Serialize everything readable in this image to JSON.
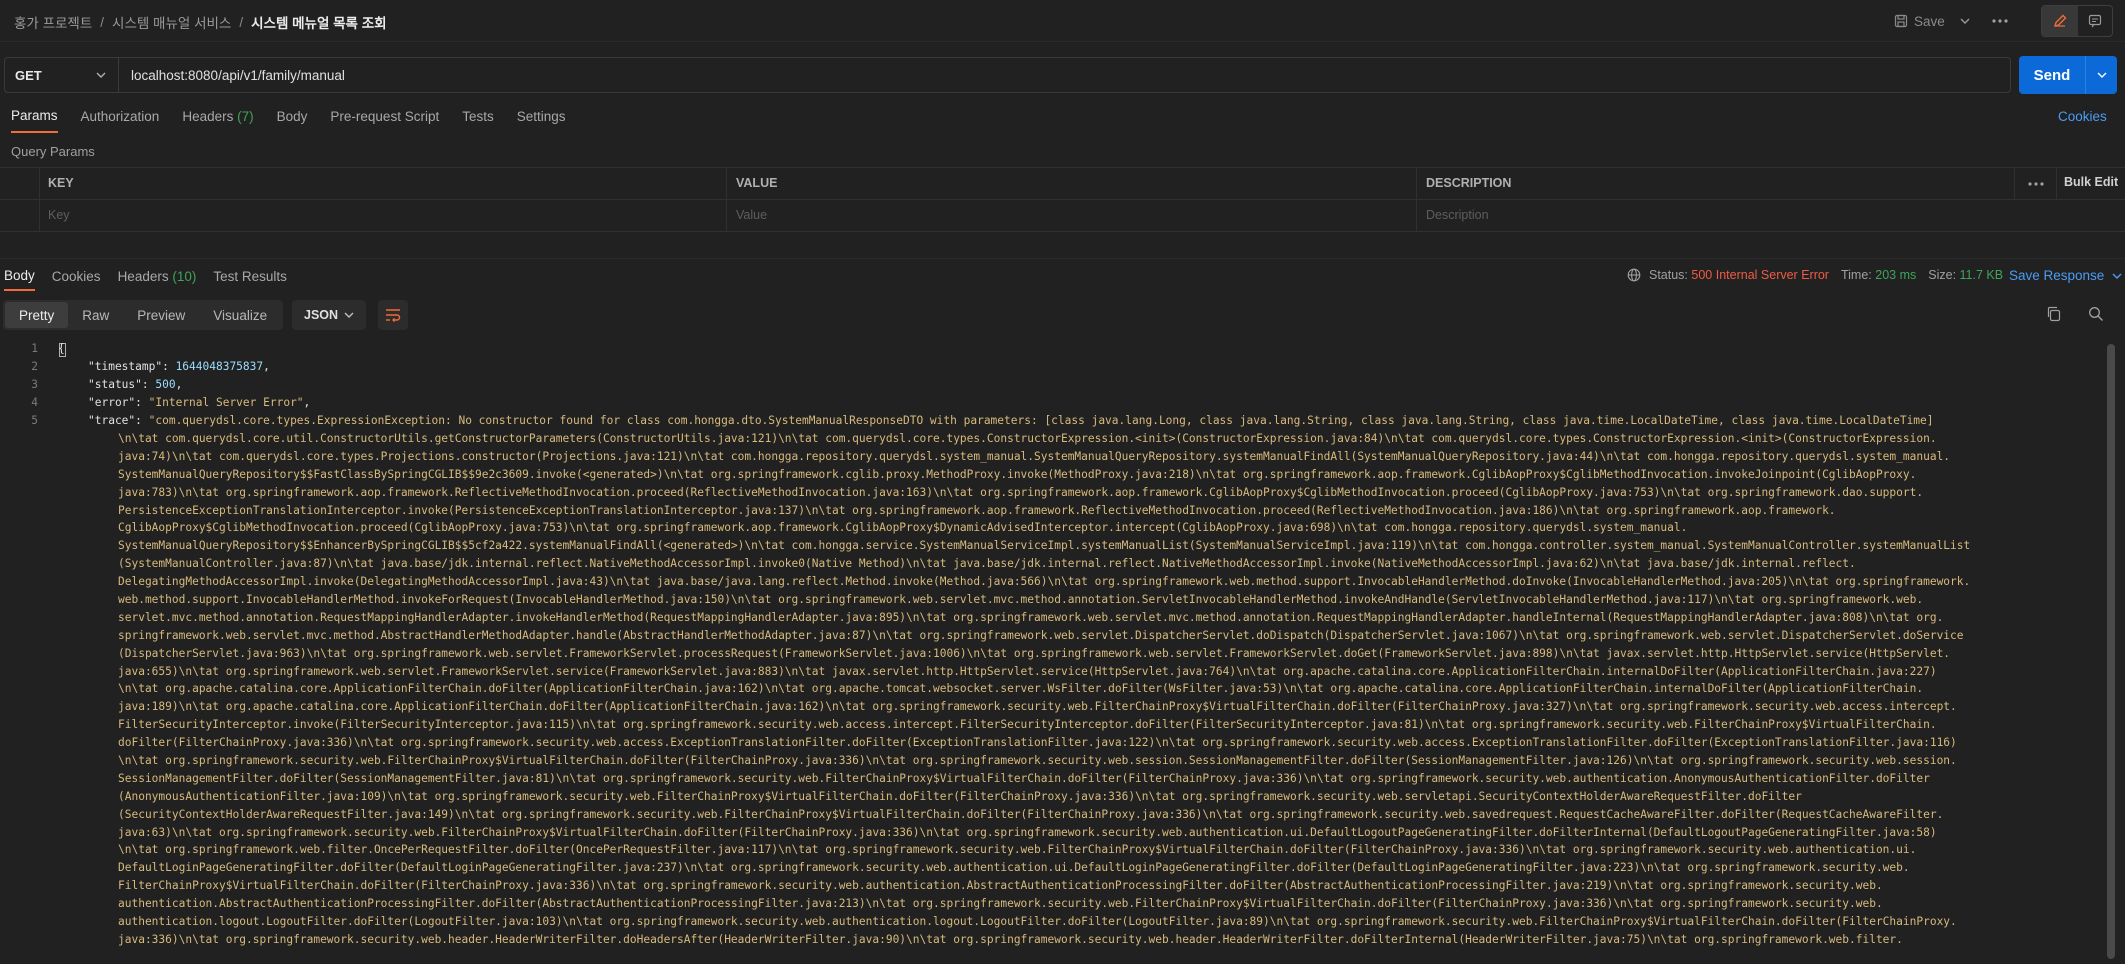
{
  "header": {
    "breadcrumb": [
      "홍가 프로젝트",
      "시스템 매뉴얼 서비스",
      "시스템 메뉴얼 목록 조회"
    ],
    "save_label": "Save"
  },
  "request": {
    "method": "GET",
    "url": "localhost:8080/api/v1/family/manual",
    "send_label": "Send"
  },
  "req_tabs": [
    {
      "label": "Params",
      "count": ""
    },
    {
      "label": "Authorization",
      "count": ""
    },
    {
      "label": "Headers",
      "count": "(7)"
    },
    {
      "label": "Body",
      "count": ""
    },
    {
      "label": "Pre-request Script",
      "count": ""
    },
    {
      "label": "Tests",
      "count": ""
    },
    {
      "label": "Settings",
      "count": ""
    }
  ],
  "cookies_label": "Cookies",
  "query_params_label": "Query Params",
  "params_table": {
    "columns": [
      "KEY",
      "VALUE",
      "DESCRIPTION"
    ],
    "placeholders": [
      "Key",
      "Value",
      "Description"
    ],
    "bulk_edit": "Bulk Edit"
  },
  "resp_tabs": [
    {
      "label": "Body",
      "count": ""
    },
    {
      "label": "Cookies",
      "count": ""
    },
    {
      "label": "Headers",
      "count": "(10)"
    },
    {
      "label": "Test Results",
      "count": ""
    }
  ],
  "response_meta": {
    "status_label": "Status:",
    "status_value": "500 Internal Server Error",
    "time_label": "Time:",
    "time_value": "203 ms",
    "size_label": "Size:",
    "size_value": "11.7 KB",
    "save_response": "Save Response"
  },
  "view_modes": [
    "Pretty",
    "Raw",
    "Preview",
    "Visualize"
  ],
  "format": "JSON",
  "code": {
    "line_numbers": [
      "1",
      "2",
      "3",
      "4",
      "5"
    ],
    "open_brace": "{",
    "timestamp_key": "\"timestamp\": ",
    "timestamp_val": "1644048375837",
    "status_key": "\"status\": ",
    "status_val": "500",
    "error_key": "\"error\": ",
    "error_val": "\"Internal Server Error\"",
    "trace_key": "\"trace\": ",
    "trace_first": "\"com.querydsl.core.types.ExpressionException: No constructor found for class com.hongga.dto.SystemManualResponseDTO with parameters: [class java.lang.Long, class java.lang.String, class java.lang.String, class java.time.LocalDateTime, class java.time.LocalDateTime]",
    "trace_lines": [
      "\\n\\tat com.querydsl.core.util.ConstructorUtils.getConstructorParameters(ConstructorUtils.java:121)\\n\\tat com.querydsl.core.types.ConstructorExpression.<init>(ConstructorExpression.java:84)\\n\\tat com.querydsl.core.types.ConstructorExpression.<init>(ConstructorExpression.",
      "java:74)\\n\\tat com.querydsl.core.types.Projections.constructor(Projections.java:121)\\n\\tat com.hongga.repository.querydsl.system_manual.SystemManualQueryRepository.systemManualFindAll(SystemManualQueryRepository.java:44)\\n\\tat com.hongga.repository.querydsl.system_manual.",
      "SystemManualQueryRepository$$FastClassBySpringCGLIB$$9e2c3609.invoke(<generated>)\\n\\tat org.springframework.cglib.proxy.MethodProxy.invoke(MethodProxy.java:218)\\n\\tat org.springframework.aop.framework.CglibAopProxy$CglibMethodInvocation.invokeJoinpoint(CglibAopProxy.",
      "java:783)\\n\\tat org.springframework.aop.framework.ReflectiveMethodInvocation.proceed(ReflectiveMethodInvocation.java:163)\\n\\tat org.springframework.aop.framework.CglibAopProxy$CglibMethodInvocation.proceed(CglibAopProxy.java:753)\\n\\tat org.springframework.dao.support.",
      "PersistenceExceptionTranslationInterceptor.invoke(PersistenceExceptionTranslationInterceptor.java:137)\\n\\tat org.springframework.aop.framework.ReflectiveMethodInvocation.proceed(ReflectiveMethodInvocation.java:186)\\n\\tat org.springframework.aop.framework.",
      "CglibAopProxy$CglibMethodInvocation.proceed(CglibAopProxy.java:753)\\n\\tat org.springframework.aop.framework.CglibAopProxy$DynamicAdvisedInterceptor.intercept(CglibAopProxy.java:698)\\n\\tat com.hongga.repository.querydsl.system_manual.",
      "SystemManualQueryRepository$$EnhancerBySpringCGLIB$$5cf2a422.systemManualFindAll(<generated>)\\n\\tat com.hongga.service.SystemManualServiceImpl.systemManualList(SystemManualServiceImpl.java:119)\\n\\tat com.hongga.controller.system_manual.SystemManualController.systemManualList",
      "(SystemManualController.java:87)\\n\\tat java.base/jdk.internal.reflect.NativeMethodAccessorImpl.invoke0(Native Method)\\n\\tat java.base/jdk.internal.reflect.NativeMethodAccessorImpl.invoke(NativeMethodAccessorImpl.java:62)\\n\\tat java.base/jdk.internal.reflect.",
      "DelegatingMethodAccessorImpl.invoke(DelegatingMethodAccessorImpl.java:43)\\n\\tat java.base/java.lang.reflect.Method.invoke(Method.java:566)\\n\\tat org.springframework.web.method.support.InvocableHandlerMethod.doInvoke(InvocableHandlerMethod.java:205)\\n\\tat org.springframework.",
      "web.method.support.InvocableHandlerMethod.invokeForRequest(InvocableHandlerMethod.java:150)\\n\\tat org.springframework.web.servlet.mvc.method.annotation.ServletInvocableHandlerMethod.invokeAndHandle(ServletInvocableHandlerMethod.java:117)\\n\\tat org.springframework.web.",
      "servlet.mvc.method.annotation.RequestMappingHandlerAdapter.invokeHandlerMethod(RequestMappingHandlerAdapter.java:895)\\n\\tat org.springframework.web.servlet.mvc.method.annotation.RequestMappingHandlerAdapter.handleInternal(RequestMappingHandlerAdapter.java:808)\\n\\tat org.",
      "springframework.web.servlet.mvc.method.AbstractHandlerMethodAdapter.handle(AbstractHandlerMethodAdapter.java:87)\\n\\tat org.springframework.web.servlet.DispatcherServlet.doDispatch(DispatcherServlet.java:1067)\\n\\tat org.springframework.web.servlet.DispatcherServlet.doService",
      "(DispatcherServlet.java:963)\\n\\tat org.springframework.web.servlet.FrameworkServlet.processRequest(FrameworkServlet.java:1006)\\n\\tat org.springframework.web.servlet.FrameworkServlet.doGet(FrameworkServlet.java:898)\\n\\tat javax.servlet.http.HttpServlet.service(HttpServlet.",
      "java:655)\\n\\tat org.springframework.web.servlet.FrameworkServlet.service(FrameworkServlet.java:883)\\n\\tat javax.servlet.http.HttpServlet.service(HttpServlet.java:764)\\n\\tat org.apache.catalina.core.ApplicationFilterChain.internalDoFilter(ApplicationFilterChain.java:227)",
      "\\n\\tat org.apache.catalina.core.ApplicationFilterChain.doFilter(ApplicationFilterChain.java:162)\\n\\tat org.apache.tomcat.websocket.server.WsFilter.doFilter(WsFilter.java:53)\\n\\tat org.apache.catalina.core.ApplicationFilterChain.internalDoFilter(ApplicationFilterChain.",
      "java:189)\\n\\tat org.apache.catalina.core.ApplicationFilterChain.doFilter(ApplicationFilterChain.java:162)\\n\\tat org.springframework.security.web.FilterChainProxy$VirtualFilterChain.doFilter(FilterChainProxy.java:327)\\n\\tat org.springframework.security.web.access.intercept.",
      "FilterSecurityInterceptor.invoke(FilterSecurityInterceptor.java:115)\\n\\tat org.springframework.security.web.access.intercept.FilterSecurityInterceptor.doFilter(FilterSecurityInterceptor.java:81)\\n\\tat org.springframework.security.web.FilterChainProxy$VirtualFilterChain.",
      "doFilter(FilterChainProxy.java:336)\\n\\tat org.springframework.security.web.access.ExceptionTranslationFilter.doFilter(ExceptionTranslationFilter.java:122)\\n\\tat org.springframework.security.web.access.ExceptionTranslationFilter.doFilter(ExceptionTranslationFilter.java:116)",
      "\\n\\tat org.springframework.security.web.FilterChainProxy$VirtualFilterChain.doFilter(FilterChainProxy.java:336)\\n\\tat org.springframework.security.web.session.SessionManagementFilter.doFilter(SessionManagementFilter.java:126)\\n\\tat org.springframework.security.web.session.",
      "SessionManagementFilter.doFilter(SessionManagementFilter.java:81)\\n\\tat org.springframework.security.web.FilterChainProxy$VirtualFilterChain.doFilter(FilterChainProxy.java:336)\\n\\tat org.springframework.security.web.authentication.AnonymousAuthenticationFilter.doFilter",
      "(AnonymousAuthenticationFilter.java:109)\\n\\tat org.springframework.security.web.FilterChainProxy$VirtualFilterChain.doFilter(FilterChainProxy.java:336)\\n\\tat org.springframework.security.web.servletapi.SecurityContextHolderAwareRequestFilter.doFilter",
      "(SecurityContextHolderAwareRequestFilter.java:149)\\n\\tat org.springframework.security.web.FilterChainProxy$VirtualFilterChain.doFilter(FilterChainProxy.java:336)\\n\\tat org.springframework.security.web.savedrequest.RequestCacheAwareFilter.doFilter(RequestCacheAwareFilter.",
      "java:63)\\n\\tat org.springframework.security.web.FilterChainProxy$VirtualFilterChain.doFilter(FilterChainProxy.java:336)\\n\\tat org.springframework.security.web.authentication.ui.DefaultLogoutPageGeneratingFilter.doFilterInternal(DefaultLogoutPageGeneratingFilter.java:58)",
      "\\n\\tat org.springframework.web.filter.OncePerRequestFilter.doFilter(OncePerRequestFilter.java:117)\\n\\tat org.springframework.security.web.FilterChainProxy$VirtualFilterChain.doFilter(FilterChainProxy.java:336)\\n\\tat org.springframework.security.web.authentication.ui.",
      "DefaultLoginPageGeneratingFilter.doFilter(DefaultLoginPageGeneratingFilter.java:237)\\n\\tat org.springframework.security.web.authentication.ui.DefaultLoginPageGeneratingFilter.doFilter(DefaultLoginPageGeneratingFilter.java:223)\\n\\tat org.springframework.security.web.",
      "FilterChainProxy$VirtualFilterChain.doFilter(FilterChainProxy.java:336)\\n\\tat org.springframework.security.web.authentication.AbstractAuthenticationProcessingFilter.doFilter(AbstractAuthenticationProcessingFilter.java:219)\\n\\tat org.springframework.security.web.",
      "authentication.AbstractAuthenticationProcessingFilter.doFilter(AbstractAuthenticationProcessingFilter.java:213)\\n\\tat org.springframework.security.web.FilterChainProxy$VirtualFilterChain.doFilter(FilterChainProxy.java:336)\\n\\tat org.springframework.security.web.",
      "authentication.logout.LogoutFilter.doFilter(LogoutFilter.java:103)\\n\\tat org.springframework.security.web.authentication.logout.LogoutFilter.doFilter(LogoutFilter.java:89)\\n\\tat org.springframework.security.web.FilterChainProxy$VirtualFilterChain.doFilter(FilterChainProxy.",
      "java:336)\\n\\tat org.springframework.security.web.header.HeaderWriterFilter.doHeadersAfter(HeaderWriterFilter.java:90)\\n\\tat org.springframework.security.web.header.HeaderWriterFilter.doFilterInternal(HeaderWriterFilter.java:75)\\n\\tat org.springframework.web.filter."
    ]
  }
}
